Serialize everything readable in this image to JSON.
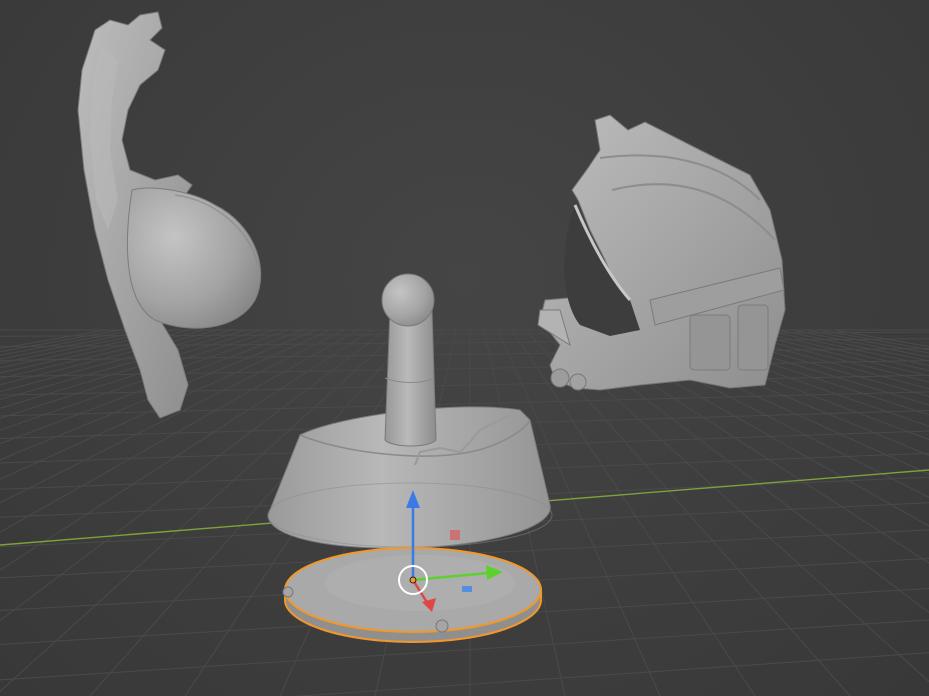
{
  "viewport": {
    "background_color": "#3d3d3d",
    "grid_color": "#4a4a4a",
    "x_axis_color": "#7fa03a",
    "model_color": "#a8a8a8",
    "selection_outline_color": "#f2982a"
  },
  "objects": [
    {
      "id": "visor-shell",
      "kind": "mesh"
    },
    {
      "id": "helmet",
      "kind": "mesh"
    },
    {
      "id": "stand-post",
      "kind": "mesh"
    },
    {
      "id": "stand-cup",
      "kind": "mesh"
    },
    {
      "id": "base-disc",
      "kind": "mesh",
      "selected": true
    }
  ],
  "gizmo": {
    "z_axis_color": "#3b7be8",
    "y_axis_color": "#5fd12e",
    "x_axis_color": "#e04646",
    "icons": [
      "move-gizmo-z-arrow",
      "move-gizmo-y-arrow",
      "move-gizmo-x-arrow",
      "origin-circle"
    ]
  }
}
